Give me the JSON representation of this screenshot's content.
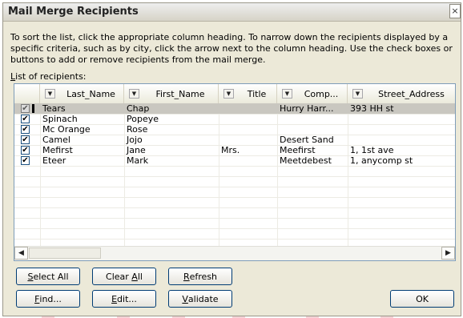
{
  "window": {
    "title": "Mail Merge Recipients",
    "close_glyph": "×"
  },
  "instructions": "To sort the list, click the appropriate column heading.  To narrow down the recipients displayed by a specific criteria, such as by city, click the arrow next to the column heading.  Use the check boxes or buttons to add or remove recipients from the mail merge.",
  "list_label": {
    "mnemonic": "L",
    "rest": "ist of recipients:"
  },
  "columns": [
    "Last_Name",
    "First_Name",
    "Title",
    "Comp...",
    "Street_Address"
  ],
  "rows": [
    {
      "checked": true,
      "selected": true,
      "cells": [
        "Tears",
        "Chap",
        "",
        "Hurry Harr...",
        "393 HH st"
      ]
    },
    {
      "checked": true,
      "selected": false,
      "cells": [
        "Spinach",
        "Popeye",
        "",
        "",
        ""
      ]
    },
    {
      "checked": true,
      "selected": false,
      "cells": [
        "Mc Orange",
        "Rose",
        "",
        "",
        ""
      ]
    },
    {
      "checked": true,
      "selected": false,
      "cells": [
        "Camel",
        "Jojo",
        "",
        "Desert Sand",
        ""
      ]
    },
    {
      "checked": true,
      "selected": false,
      "cells": [
        "Mefirst",
        "Jane",
        "Mrs.",
        "Meefirst",
        "1, 1st ave"
      ]
    },
    {
      "checked": true,
      "selected": false,
      "cells": [
        "Eteer",
        "Mark",
        "",
        "Meetdebest",
        "1, anycomp st"
      ]
    }
  ],
  "check_glyph": "✔",
  "scroll": {
    "left_glyph": "◀",
    "right_glyph": "▶"
  },
  "dropdown_glyph": "▼",
  "buttons": {
    "select_all": {
      "mnemonic": "S",
      "rest": "elect All"
    },
    "clear_all": {
      "before": "Clear ",
      "mnemonic": "A",
      "rest": "ll"
    },
    "refresh": {
      "mnemonic": "R",
      "rest": "efresh"
    },
    "find": {
      "mnemonic": "F",
      "rest": "ind..."
    },
    "edit": {
      "mnemonic": "E",
      "rest": "dit..."
    },
    "validate": {
      "mnemonic": "V",
      "rest": "alidate"
    },
    "ok": "OK"
  },
  "watermark": "DropBooks"
}
